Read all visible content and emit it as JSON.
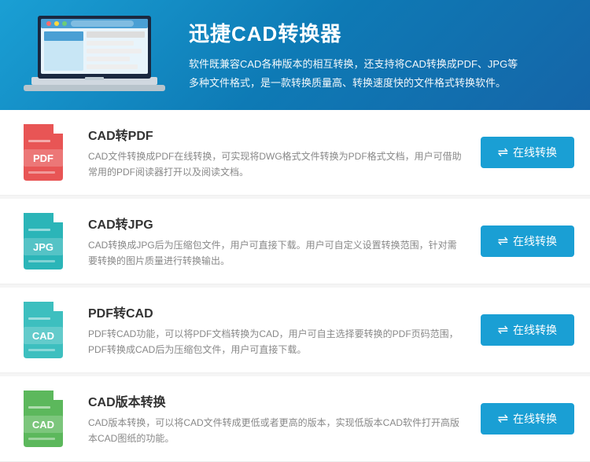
{
  "header": {
    "title": "迅捷CAD转换器",
    "desc": "软件既兼容CAD各种版本的相互转换，还支持将CAD转换成PDF、JPG等多种文件格式，是一款转换质量高、转换速度快的文件格式转换软件。"
  },
  "features": [
    {
      "id": "cad-to-pdf",
      "icon_type": "pdf",
      "title": "CAD转PDF",
      "desc": "CAD文件转换成PDF在线转换，可实现将DWG格式文件转换为PDF格式文档，用户可借助常用的PDF阅读器打开以及阅读文档。",
      "btn_label": "在线转换"
    },
    {
      "id": "cad-to-jpg",
      "icon_type": "jpg",
      "title": "CAD转JPG",
      "desc": "CAD转换成JPG后为压缩包文件，用户可直接下载。用户可自定义设置转换范围，针对需要转换的图片质量进行转换输出。",
      "btn_label": "在线转换"
    },
    {
      "id": "pdf-to-cad",
      "icon_type": "cad-teal",
      "title": "PDF转CAD",
      "desc": "PDF转CAD功能，可以将PDF文档转换为CAD，用户可自主选择要转换的PDF页码范围，PDF转换成CAD后为压缩包文件，用户可直接下载。",
      "btn_label": "在线转换"
    },
    {
      "id": "cad-version",
      "icon_type": "cad-green",
      "title": "CAD版本转换",
      "desc": "CAD版本转换，可以将CAD文件转成更低或者更高的版本，实现低版本CAD软件打开高版本CAD图纸的功能。",
      "btn_label": "在线转换"
    }
  ],
  "icons": {
    "convert": "⇌"
  }
}
